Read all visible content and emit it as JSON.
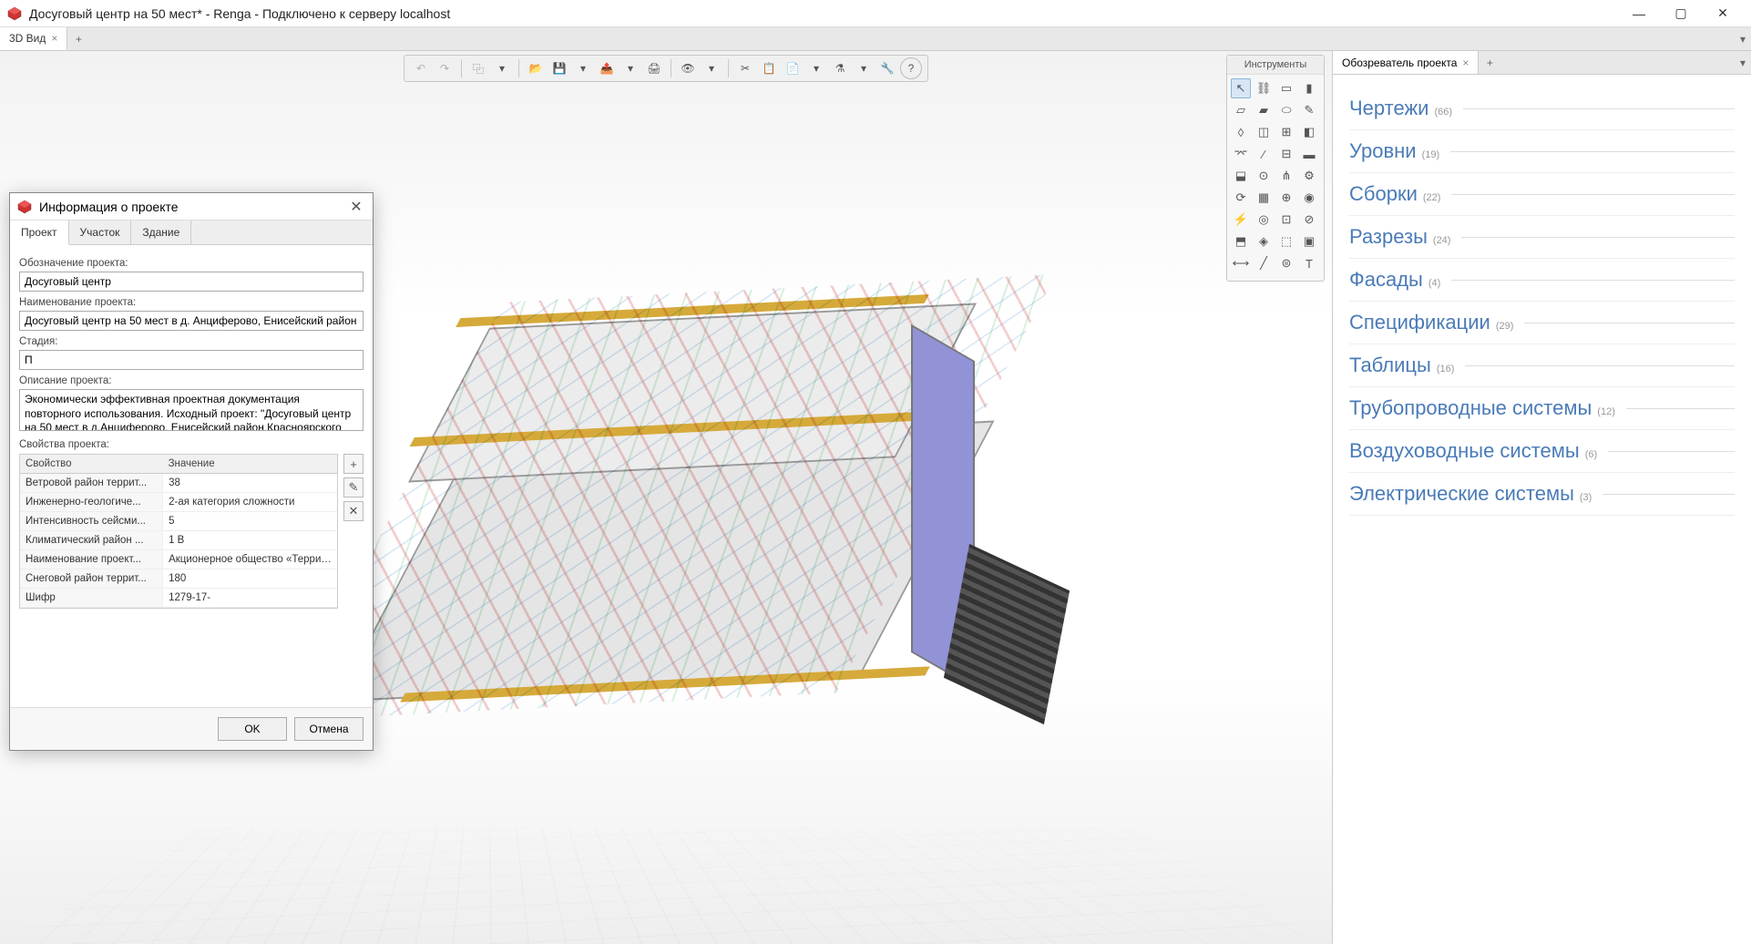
{
  "window": {
    "title": "Досуговый центр на 50 мест* - Renga - Подключено к серверу localhost"
  },
  "mainTab": {
    "label": "3D Вид"
  },
  "toolsPanel": {
    "title": "Инструменты"
  },
  "browser": {
    "tabLabel": "Обозреватель проекта",
    "items": [
      {
        "label": "Чертежи",
        "count": "(66)"
      },
      {
        "label": "Уровни",
        "count": "(19)"
      },
      {
        "label": "Сборки",
        "count": "(22)"
      },
      {
        "label": "Разрезы",
        "count": "(24)"
      },
      {
        "label": "Фасады",
        "count": "(4)"
      },
      {
        "label": "Спецификации",
        "count": "(29)"
      },
      {
        "label": "Таблицы",
        "count": "(16)"
      },
      {
        "label": "Трубопроводные системы",
        "count": "(12)"
      },
      {
        "label": "Воздуховодные системы",
        "count": "(6)"
      },
      {
        "label": "Электрические системы",
        "count": "(3)"
      }
    ]
  },
  "dialog": {
    "title": "Информация о проекте",
    "tabs": {
      "project": "Проект",
      "site": "Участок",
      "building": "Здание"
    },
    "labels": {
      "code": "Обозначение проекта:",
      "name": "Наименование проекта:",
      "stage": "Стадия:",
      "description": "Описание проекта:",
      "props": "Свойства проекта:"
    },
    "values": {
      "code": "Досуговый центр",
      "name": "Досуговый центр на 50 мест в д. Анциферово, Енисейский район Красноярского края",
      "stage": "П",
      "description": "Экономически эффективная проектная документация повторного использования. Исходный проект: \"Досуговый центр на 50 мест в д.Анциферово, Енисейский район Красноярского края\"."
    },
    "propsHeader": {
      "name": "Свойство",
      "value": "Значение"
    },
    "props": [
      {
        "name": "Ветровой район террит...",
        "value": "38"
      },
      {
        "name": "Инженерно-геологиче...",
        "value": "2-ая категория сложности"
      },
      {
        "name": "Интенсивность сейсми...",
        "value": "5"
      },
      {
        "name": "Климатический район ...",
        "value": "1 В"
      },
      {
        "name": "Наименование проект...",
        "value": "Акционерное общество «Территориальный гр..."
      },
      {
        "name": "Снеговой район террит...",
        "value": "180"
      },
      {
        "name": "Шифр",
        "value": "1279-17-"
      }
    ],
    "buttons": {
      "ok": "OK",
      "cancel": "Отмена"
    }
  }
}
